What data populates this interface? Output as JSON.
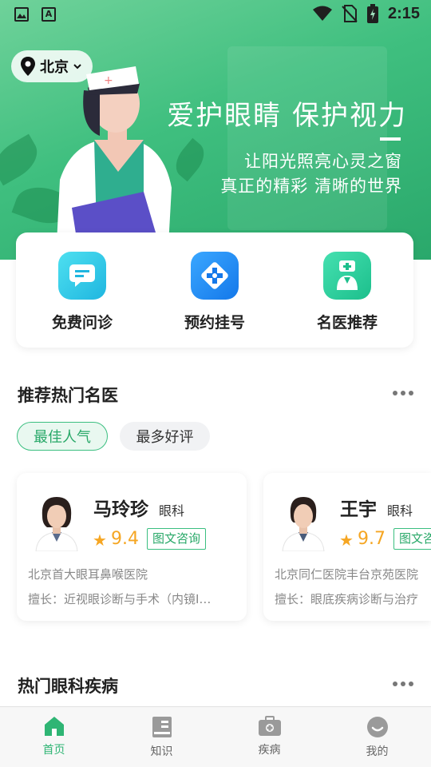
{
  "status_bar": {
    "time": "2:15"
  },
  "location": {
    "city": "北京"
  },
  "banner": {
    "title": "爱护眼睛  保护视力",
    "subtitle_1": "让阳光照亮心灵之窗",
    "subtitle_2": "真正的精彩  清晰的世界"
  },
  "quick_actions": [
    {
      "label": "免费问诊",
      "icon": "chat-icon",
      "color": "#2ec9e8"
    },
    {
      "label": "预约挂号",
      "icon": "hospital-cross-icon",
      "color": "#1f8ff0"
    },
    {
      "label": "名医推荐",
      "icon": "doctor-icon",
      "color": "#2fcf9c"
    }
  ],
  "recommend_section": {
    "title": "推荐热门名医",
    "tabs": [
      "最佳人气",
      "最多好评"
    ]
  },
  "doctors": [
    {
      "name": "马玲珍",
      "dept": "眼科",
      "rating": "9.4",
      "tag": "图文咨询",
      "hospital": "北京首大眼耳鼻喉医院",
      "specialty": "擅长：近视眼诊断与手术（内镜I…"
    },
    {
      "name": "王宇",
      "dept": "眼科",
      "rating": "9.7",
      "tag": "图文咨询",
      "hospital": "北京同仁医院丰台京苑医院",
      "specialty": "擅长：眼底疾病诊断与治疗"
    }
  ],
  "disease_section": {
    "title": "热门眼科疾病"
  },
  "bottom_nav": [
    {
      "label": "首页",
      "active": true
    },
    {
      "label": "知识",
      "active": false
    },
    {
      "label": "疾病",
      "active": false
    },
    {
      "label": "我的",
      "active": false
    }
  ],
  "colors": {
    "primary": "#2fb574",
    "banner": "#3fbf7f"
  }
}
